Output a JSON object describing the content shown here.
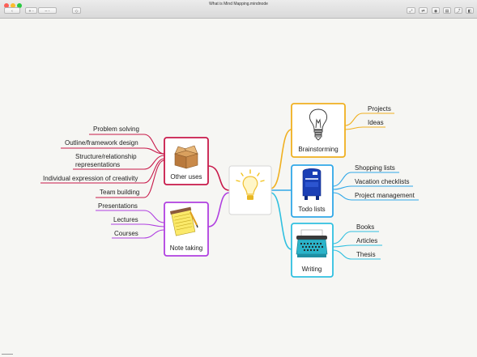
{
  "window": {
    "title": "What is Mind Mapping.mindnode"
  },
  "toolbar": {
    "left_buttons": [
      "‹",
      "+ ◦",
      "– ◦",
      "◇"
    ],
    "right_buttons": [
      "⤢",
      "⇄",
      "◉",
      "▤",
      "⤴",
      "◧"
    ]
  },
  "colors": {
    "other_uses": "#c8194a",
    "note_taking": "#b040e0",
    "brainstorming": "#f0b020",
    "todo_lists": "#30a8e8",
    "writing": "#30c0e0",
    "center_border": "#cfcfcf"
  },
  "center": {
    "icon": "lightbulb-icon"
  },
  "nodes": {
    "other_uses": {
      "label": "Other uses",
      "icon": "cardboard-box-icon"
    },
    "note_taking": {
      "label": "Note taking",
      "icon": "notepad-icon"
    },
    "brainstorming": {
      "label": "Brainstorming",
      "icon": "lightbulb-sketch-icon"
    },
    "todo_lists": {
      "label": "Todo lists",
      "icon": "mailbox-icon"
    },
    "writing": {
      "label": "Writing",
      "icon": "typewriter-icon"
    }
  },
  "leaves": {
    "other_uses": [
      "Problem solving",
      "Outline/framework design",
      "Structure/relationship",
      "representations",
      "Individual expression of creativity",
      "Team building"
    ],
    "note_taking": [
      "Presentations",
      "Lectures",
      "Courses"
    ],
    "brainstorming": [
      "Projects",
      "Ideas"
    ],
    "todo_lists": [
      "Shopping lists",
      "Vacation checklists",
      "Project management"
    ],
    "writing": [
      "Books",
      "Articles",
      "Thesis"
    ]
  }
}
